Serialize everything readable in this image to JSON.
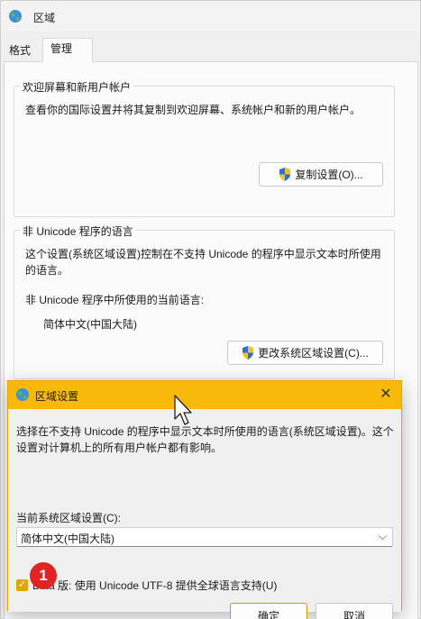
{
  "window": {
    "title": "区域"
  },
  "tabs": [
    {
      "label": "格式"
    },
    {
      "label": "管理"
    }
  ],
  "welcome_group": {
    "legend": "欢迎屏幕和新用户帐户",
    "description": "查看你的国际设置并将其复制到欢迎屏幕、系统帐户和新的用户帐户。",
    "copy_button": "复制设置(O)..."
  },
  "nonunicode_group": {
    "legend": "非 Unicode 程序的语言",
    "description": "这个设置(系统区域设置)控制在不支持 Unicode 的程序中显示文本时所使用的语言。",
    "current_label": "非 Unicode 程序中所使用的当前语言:",
    "current_value": "简体中文(中国大陆)",
    "change_button": "更改系统区域设置(C)..."
  },
  "dialog": {
    "title": "区域设置",
    "close": "✕",
    "description": "选择在不支持 Unicode 的程序中显示文本时所使用的语言(系统区域设置)。这个设置对计算机上的所有用户帐户都有影响。",
    "current_label": "当前系统区域设置(C):",
    "select_value": "简体中文(中国大陆)",
    "beta_checkbox_label": "Beta 版: 使用 Unicode UTF-8 提供全球语言支持(U)",
    "beta_checked": true,
    "ok_button": "确定",
    "cancel_button": "取消"
  },
  "annotation": {
    "step": "1"
  },
  "colors": {
    "dialog_title": "#f8b90b",
    "accent": "#e6a400",
    "badge": "#e02424"
  }
}
